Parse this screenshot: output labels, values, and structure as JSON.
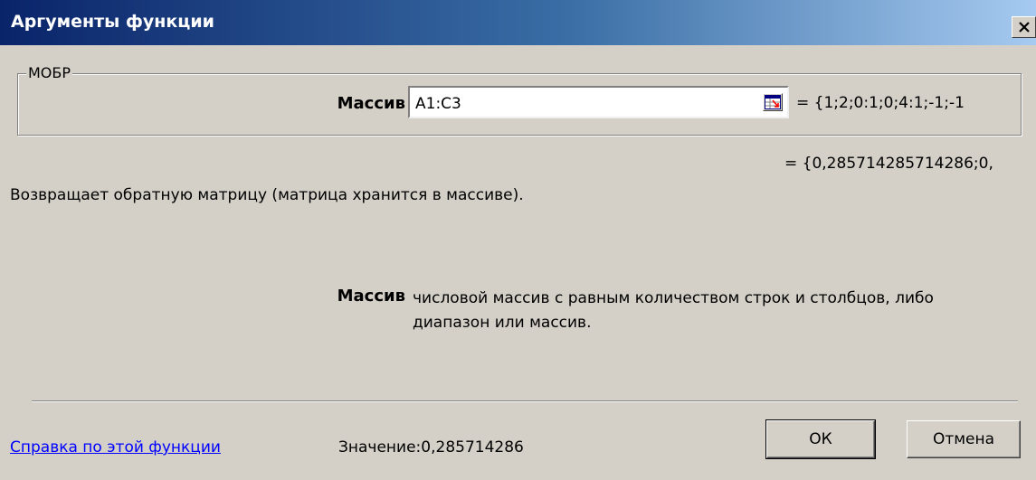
{
  "window": {
    "title": "Аргументы функции"
  },
  "function": {
    "name": "МОБР",
    "argument": {
      "label": "Массив",
      "value": "A1:C3",
      "evaluated": "= {1;2;0:1;0;4:1;-1;-1"
    },
    "result_preview": "= {0,285714285714286;0,",
    "description": "Возвращает обратную матрицу (матрица хранится в массиве).",
    "argument_help": {
      "name": "Массив",
      "text": "числовой массив с равным количеством строк и столбцов, либо диапазон или массив."
    }
  },
  "footer": {
    "help_link": "Справка по этой функции",
    "value_label": "Значение:",
    "value": "0,285714286",
    "ok_label": "ОК",
    "cancel_label": "Отмена"
  },
  "icons": {
    "close": "close-icon",
    "range_select": "collapse-dialog-icon"
  },
  "colors": {
    "title_start": "#0a246a",
    "title_end": "#a6caf0",
    "dialog_bg": "#d4d0c8",
    "link": "#0000ff"
  }
}
